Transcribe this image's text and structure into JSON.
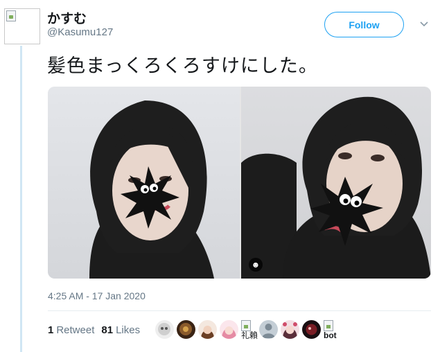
{
  "user": {
    "display_name": "かすむ",
    "screen_name": "@Kasumu127"
  },
  "actions": {
    "follow_label": "Follow"
  },
  "tweet": {
    "text": "髪色まっくろくろすけにした。",
    "timestamp": "4:25 AM - 17 Jan 2020"
  },
  "stats": {
    "retweet_count": "1",
    "retweet_label": "Retweet",
    "like_count": "81",
    "like_label": "Likes"
  },
  "likers": {
    "broken_alt_1": "礼賴",
    "broken_alt_2": "bot"
  },
  "colors": {
    "accent": "#1da1f2",
    "thread_line": "#d0e6f4",
    "muted_text": "#657786"
  }
}
